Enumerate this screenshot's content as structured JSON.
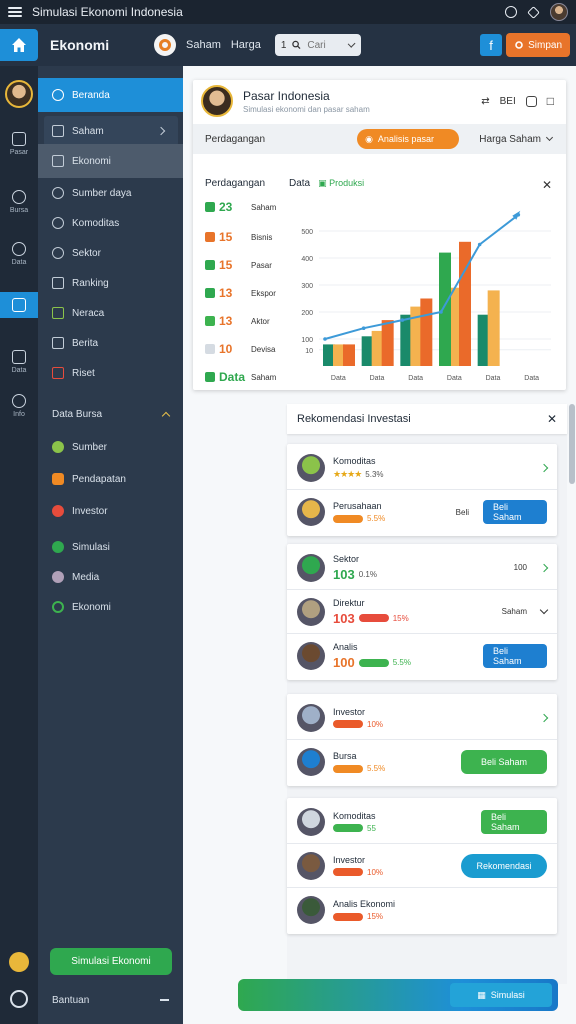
{
  "titlebar": {
    "title": "Simulasi Ekonomi Indonesia"
  },
  "topnav": {
    "brand": "Ekonomi",
    "links": [
      "Saham",
      "Harga"
    ],
    "search": {
      "number": "1",
      "placeholder": "Cari"
    },
    "fb_label": "f",
    "orange_button": "Simpan"
  },
  "rail": {
    "items": [
      "Pasar",
      "Bursa",
      "Data",
      "Data",
      "Info"
    ]
  },
  "sidebar": {
    "items": [
      {
        "label": "Beranda"
      },
      {
        "label": "Saham"
      },
      {
        "label": "Ekonomi"
      },
      {
        "label": "Sumber daya"
      },
      {
        "label": "Komoditas"
      },
      {
        "label": "Sektor"
      },
      {
        "label": "Ranking"
      },
      {
        "label": "Neraca"
      },
      {
        "label": "Berita"
      },
      {
        "label": "Riset"
      }
    ],
    "section": "Data Bursa",
    "section_items": [
      {
        "label": "Sumber",
        "color": "#8bc34a"
      },
      {
        "label": "Pendapatan",
        "color": "#f08a24"
      },
      {
        "label": "Investor",
        "color": "#e74c3c"
      },
      {
        "label": "Simulasi",
        "color": "#2fa84f"
      },
      {
        "label": "Media",
        "color": "#b0a0b8"
      },
      {
        "label": "Ekonomi",
        "color": "#3db34f"
      }
    ],
    "green_button": "Simulasi Ekonomi",
    "footer": "Bantuan"
  },
  "dashboard": {
    "title": "Pasar Indonesia",
    "subtitle": "Simulasi ekonomi dan pasar saham",
    "icons_label": "BEI",
    "bar_label": "Perdagangan",
    "orange_pill": "Analisis pasar",
    "sort_label": "Harga Saham",
    "stats_title": "Perdagangan",
    "stats": [
      {
        "value": "23",
        "label": "Saham",
        "color": "#2fa84f",
        "vcolor": "#2fa84f"
      },
      {
        "value": "15",
        "label": "Bisnis",
        "color": "#e8742a",
        "vcolor": "#e8742a"
      },
      {
        "value": "15",
        "label": "Pasar",
        "color": "#2fa84f",
        "vcolor": "#e8742a"
      },
      {
        "value": "13",
        "label": "Ekspor",
        "color": "#2fa84f",
        "vcolor": "#e8742a"
      },
      {
        "value": "13",
        "label": "Aktor",
        "color": "#3db34f",
        "vcolor": "#e8742a"
      },
      {
        "value": "10",
        "label": "Devisa",
        "color": "#d5dbe2",
        "vcolor": "#e8742a"
      },
      {
        "value": "Data",
        "label": "Saham",
        "color": "#2fa84f",
        "vcolor": "#2fa84f"
      }
    ],
    "chart_title": "Data",
    "chart_legend": "Produksi"
  },
  "chart_data": {
    "type": "bar",
    "categories": [
      "Data",
      "Data",
      "Data",
      "Data",
      "Data",
      "Data"
    ],
    "y_ticks": [
      "10",
      "100",
      "200",
      "300",
      "400",
      "500"
    ],
    "ylim": [
      0,
      600
    ],
    "series": [
      {
        "color": "#1a8a6a",
        "values": [
          80,
          110,
          190,
          310,
          190
        ]
      },
      {
        "color": "#f4b24f",
        "values": [
          80,
          130,
          220,
          290,
          280
        ]
      },
      {
        "color": "#ea6a2a",
        "values": [
          80,
          170,
          250,
          460,
          0
        ]
      },
      {
        "color": "#2fa84f",
        "values": [
          0,
          0,
          0,
          420,
          0
        ]
      }
    ],
    "line": {
      "color": "#3d9ad8",
      "values": [
        100,
        140,
        170,
        200,
        450,
        560
      ]
    },
    "grid": true,
    "legend": "top-left"
  },
  "recommendations": {
    "title": "Rekomendasi Investasi",
    "cards": [
      {
        "rows": [
          {
            "name": "Komoditas",
            "big": "",
            "stars": "★★★★",
            "pct": "5.3%",
            "right_text": "",
            "action": "chev-r",
            "button": ""
          },
          {
            "name": "Perusahaan",
            "big": "",
            "bar": "5.5%",
            "bar_color": "#f08a24",
            "right_text": "Beli",
            "action": "",
            "button": "Beli Saham"
          }
        ]
      },
      {
        "rows": [
          {
            "name": "Sektor",
            "big": "103",
            "pct": "0.1%",
            "right_text": "100",
            "action": "chev-r",
            "button": ""
          },
          {
            "name": "Direktur",
            "big": "103",
            "bar": "15%",
            "bar_color": "#e74c3c",
            "right_text": "Saham",
            "action": "chev-d",
            "button": ""
          },
          {
            "name": "Analis",
            "big": "100",
            "bar": "5.5%",
            "bar_color": "#3db34f",
            "right_text": "",
            "action": "",
            "button": "Beli Saham"
          }
        ]
      },
      {
        "rows": [
          {
            "name": "Investor",
            "big": "",
            "bar": "10%",
            "bar_color": "#ea5a2a",
            "right_text": "",
            "action": "chev-r",
            "button": ""
          },
          {
            "name": "Bursa",
            "big": "",
            "bar": "5.5%",
            "bar_color": "#f08a24",
            "right_text": "",
            "action": "",
            "button": "Beli Saham"
          }
        ]
      },
      {
        "rows": [
          {
            "name": "Komoditas",
            "big": "",
            "bar": "55",
            "bar_color": "#3db34f",
            "right_text": "",
            "action": "",
            "button": "Beli Saham"
          },
          {
            "name": "Investor",
            "big": "",
            "bar": "10%",
            "bar_color": "#ea5a2a",
            "right_text": "",
            "action": "",
            "button": "Rekomendasi"
          },
          {
            "name": "Analis Ekonomi",
            "big": "",
            "bar": "15%",
            "bar_color": "#ea5a2a",
            "right_text": "",
            "action": "",
            "button": ""
          }
        ]
      }
    ]
  },
  "bottom_bar": {
    "button": "Simulasi"
  }
}
